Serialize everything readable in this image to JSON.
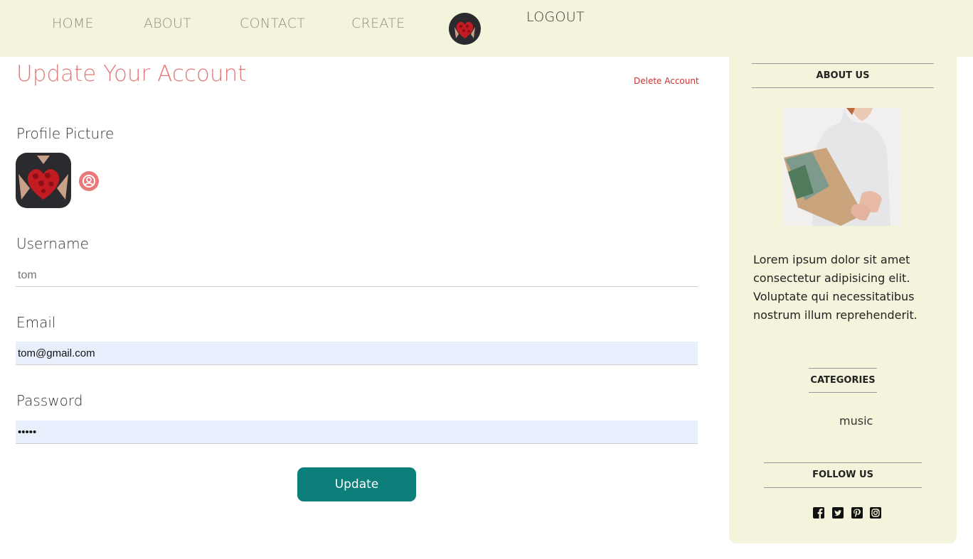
{
  "nav": {
    "home": "HOME",
    "about": "ABOUT",
    "contact": "CONTACT",
    "create": "CREATE",
    "logout": "LOGOUT"
  },
  "form": {
    "title": "Update Your Account",
    "delete_link": "Delete Account",
    "profile_label": "Profile Picture",
    "username_label": "Username",
    "username_placeholder": "tom",
    "email_label": "Email",
    "email_value": "tom@gmail.com",
    "password_label": "Password",
    "password_value": "•••••",
    "submit_label": "Update"
  },
  "sidebar": {
    "about_heading": "ABOUT US",
    "about_text": "Lorem ipsum dolor sit amet consectetur adipisicing elit. Voluptate qui necessitatibus nostrum illum reprehenderit.",
    "categories_heading": "CATEGORIES",
    "categories": [
      "music"
    ],
    "follow_heading": "FOLLOW US",
    "social_icons": [
      "facebook-icon",
      "twitter-icon",
      "pinterest-icon",
      "instagram-icon"
    ]
  },
  "colors": {
    "topbar_bg": "#f4f4dc",
    "title_color": "#e07b7b",
    "button_bg": "#0d7f7b",
    "delete_color": "#d23030"
  }
}
